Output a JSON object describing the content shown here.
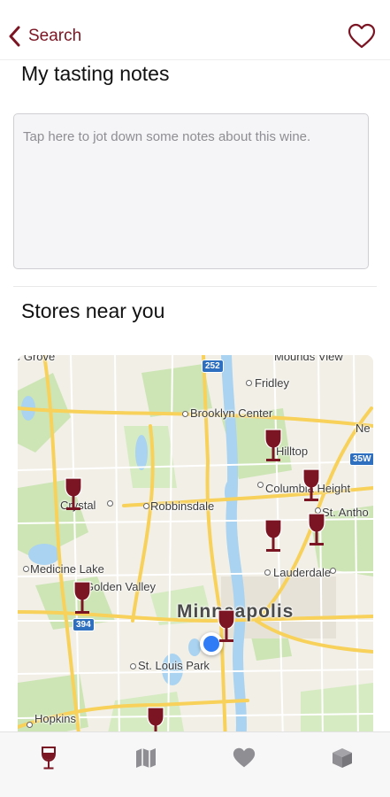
{
  "nav": {
    "back_label": "Search",
    "accent": "#7b1523",
    "favorite_icon": "heart-outline-icon"
  },
  "notes_section": {
    "title": "My tasting notes",
    "placeholder": "Tap here to jot down some notes about this wine."
  },
  "stores_section": {
    "title": "Stores near you"
  },
  "map": {
    "labels": {
      "grove": "e Grove",
      "mounds_view": "Mounds View",
      "fridley": "Fridley",
      "brooklyn_center": "Brooklyn Center",
      "ne": "Ne",
      "hilltop": "Hilltop",
      "columbia_heights": "Columbia Height",
      "st_anthony": "St. Antho",
      "crystal": "Crystal",
      "robbinsdale": "Robbinsdale",
      "medicine_lake": "Medicine Lake",
      "golden_valley": "Golden Valley",
      "lauderdale": "Lauderdale",
      "minneapolis": "Minneapolis",
      "st_louis_park": "St. Louis Park",
      "hopkins": "Hopkins"
    },
    "shields": {
      "i252": "252",
      "i35w": "35W",
      "i394": "394"
    },
    "pin_icon": "wine-glass-pin-icon",
    "pin_color": "#7b1523"
  },
  "tabbar": {
    "tabs": [
      {
        "icon": "wine-glass-icon",
        "active": true
      },
      {
        "icon": "map-icon",
        "active": false
      },
      {
        "icon": "heart-icon",
        "active": false
      },
      {
        "icon": "box-icon",
        "active": false
      }
    ],
    "active_color": "#7b1523",
    "inactive_color": "#8e8e93"
  }
}
